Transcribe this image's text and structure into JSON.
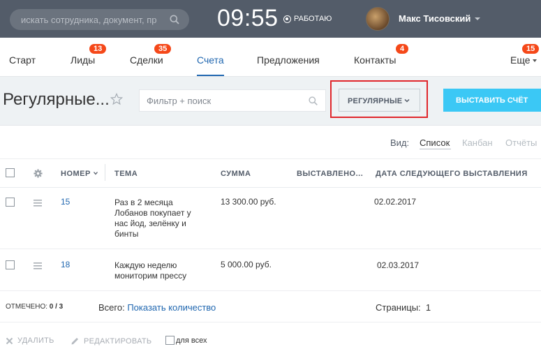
{
  "header": {
    "search_placeholder": "искать сотрудника, документ, пр",
    "clock": "09:55",
    "status": "РАБОТАЮ",
    "user_name": "Макс Тисовский"
  },
  "nav": {
    "items": [
      {
        "label": "Старт"
      },
      {
        "label": "Лиды",
        "badge": "13"
      },
      {
        "label": "Сделки",
        "badge": "35"
      },
      {
        "label": "Счета",
        "active": true
      },
      {
        "label": "Предложения"
      },
      {
        "label": "Контакты",
        "badge": "4"
      },
      {
        "label": "Еще",
        "badge": "15"
      }
    ]
  },
  "toolbar": {
    "title": "Регулярные...",
    "filter_placeholder": "Фильтр + поиск",
    "preset_label": "РЕГУЛЯРНЫЕ",
    "create_label": "ВЫСТАВИТЬ СЧЁТ"
  },
  "views": {
    "label": "Вид:",
    "list": "Список",
    "kanban": "Канбан",
    "reports": "Отчёты"
  },
  "table": {
    "columns": [
      "НОМЕР",
      "ТЕМА",
      "СУММА",
      "ВЫСТАВЛЕНО...",
      "ДАТА СЛЕДУЮЩЕГО ВЫСТАВЛЕНИЯ"
    ],
    "rows": [
      {
        "number": "15",
        "topic": [
          "Раз в 2 месяца",
          "Лобанов покупает у",
          "нас йод, зелёнку и",
          "бинты"
        ],
        "sum": "13 300.00 руб.",
        "issued": "",
        "next_date": "02.02.2017"
      },
      {
        "number": "18",
        "topic": [
          "Каждую неделю",
          "мониторим прессу"
        ],
        "sum": "5 000.00 руб.",
        "issued": "",
        "next_date": "02.03.2017"
      }
    ]
  },
  "footer": {
    "selected_label": "ОТМЕЧЕНО:",
    "selected_value": "0 / 3",
    "total_label": "Всего:",
    "total_link": "Показать количество",
    "pages_label": "Страницы:",
    "pages_value": "1"
  },
  "actions": {
    "delete": "УДАЛИТЬ",
    "edit": "РЕДАКТИРОВАТЬ",
    "for_all": "для всех"
  },
  "colors": {
    "header_bg": "#535c69",
    "accent": "#2067b0",
    "badge": "#f54819",
    "primary_button": "#3bc8f5",
    "highlight_box": "#e0262b"
  }
}
